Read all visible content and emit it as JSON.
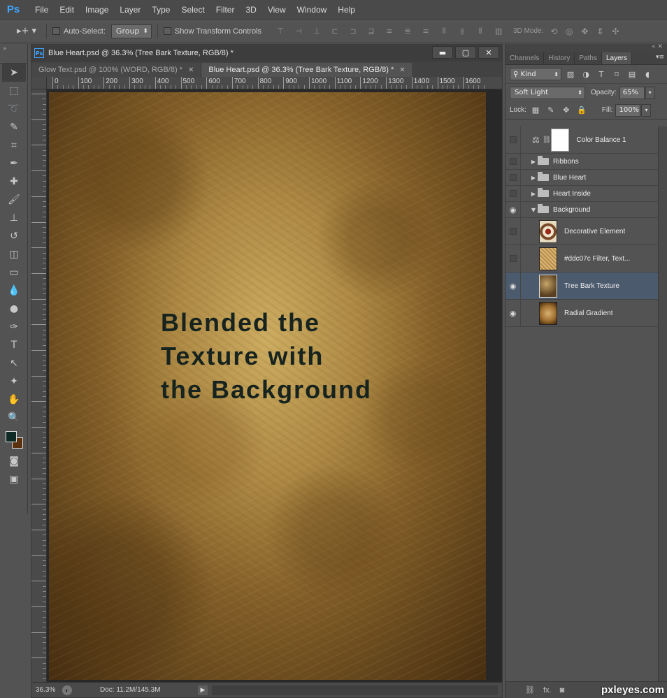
{
  "app": {
    "logo": "Ps"
  },
  "menu": [
    "File",
    "Edit",
    "Image",
    "Layer",
    "Type",
    "Select",
    "Filter",
    "3D",
    "View",
    "Window",
    "Help"
  ],
  "options": {
    "auto_select_label": "Auto-Select:",
    "auto_select_value": "Group",
    "transform_label": "Show Transform Controls",
    "mode3d_label": "3D Mode:"
  },
  "document": {
    "title": "Blue Heart.psd @ 36.3% (Tree Bark Texture, RGB/8) *",
    "tabs": [
      {
        "label": "Glow Text.psd @ 100% (WORD, RGB/8) *"
      },
      {
        "label": "Blue Heart.psd @ 36.3% (Tree Bark Texture, RGB/8) *"
      }
    ],
    "ruler_top": [
      "0",
      "100",
      "200",
      "300",
      "400",
      "500",
      "600",
      "700",
      "800",
      "900",
      "1000",
      "1100",
      "1200",
      "1300",
      "1400",
      "1500",
      "1600"
    ],
    "canvas_text": [
      "Blended the",
      "Texture with",
      "the Background"
    ],
    "status": {
      "zoom": "36.3%",
      "doc_info": "Doc: 11.2M/145.3M"
    },
    "colors": {
      "foreground": "#0f2a24",
      "background": "#5a3210"
    }
  },
  "layers_panel": {
    "tabs": [
      {
        "label": "Channels",
        "active": false
      },
      {
        "label": "History",
        "active": false
      },
      {
        "label": "Paths",
        "active": false
      },
      {
        "label": "Layers",
        "active": true
      }
    ],
    "filter_kind": "Kind",
    "blend_mode": "Soft Light",
    "opacity_label": "Opacity:",
    "opacity_value": "65%",
    "lock_label": "Lock:",
    "fill_label": "Fill:",
    "fill_value": "100%",
    "layers": [
      {
        "name": "Color Balance 1",
        "type": "adjustment",
        "visible": false
      },
      {
        "name": "Ribbons",
        "type": "group",
        "visible": false
      },
      {
        "name": "Blue Heart",
        "type": "group",
        "visible": false
      },
      {
        "name": "Heart Inside",
        "type": "group",
        "visible": false
      },
      {
        "name": "Background",
        "type": "group-open",
        "visible": true
      },
      {
        "name": "Decorative Element",
        "type": "pixel",
        "visible": false
      },
      {
        "name": "#ddc07c  Filter, Text...",
        "type": "pixel",
        "visible": false
      },
      {
        "name": "Tree Bark Texture",
        "type": "pixel",
        "visible": true,
        "selected": true
      },
      {
        "name": "Radial Gradient",
        "type": "pixel",
        "visible": true
      }
    ],
    "bottom_icons": [
      "link-icon",
      "fx-icon",
      "mask-icon"
    ],
    "bottom_fx_label": "fx."
  },
  "watermark": "pxleyes.com"
}
